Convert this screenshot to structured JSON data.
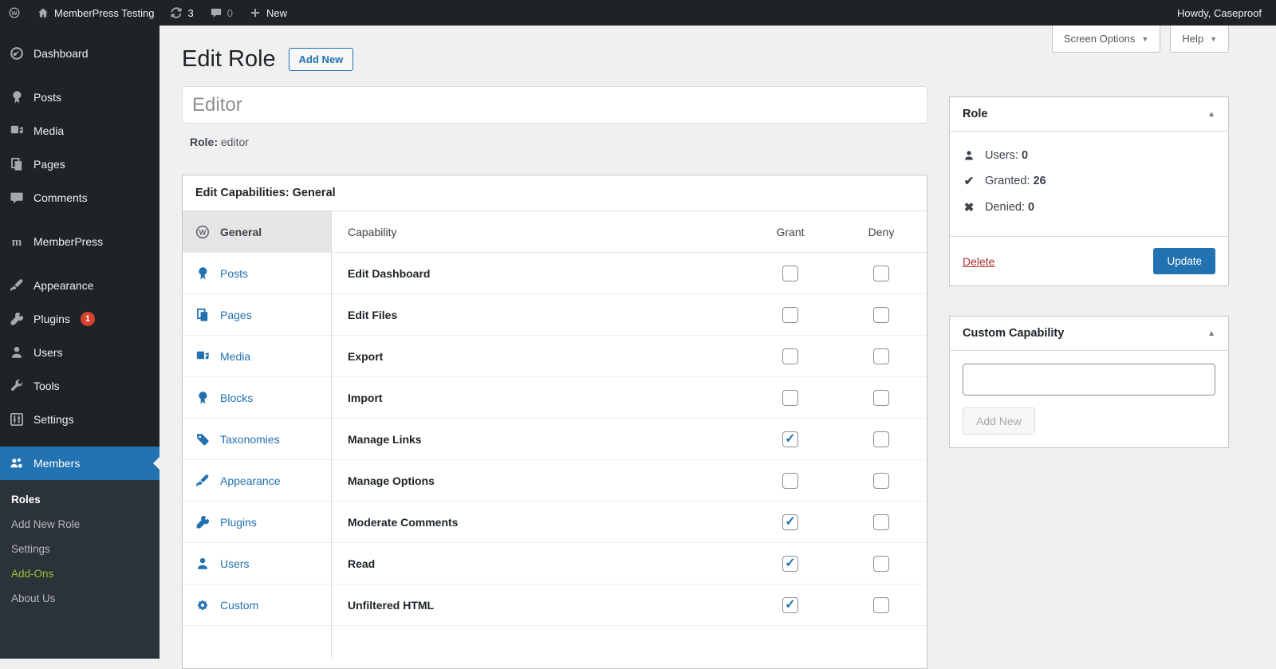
{
  "admin_bar": {
    "site_name": "MemberPress Testing",
    "update_count": "3",
    "comment_count": "0",
    "new_label": "New",
    "howdy": "Howdy, Caseproof"
  },
  "colors": {
    "accent_blue": "#2271b1",
    "menu_dark": "#1d2327",
    "submenu_bg": "#2c3338",
    "badge_red": "#d5432f",
    "addons_green": "#95bf3b",
    "delete_red": "#b32d2e"
  },
  "sidebar": {
    "items": [
      {
        "label": "Dashboard"
      },
      {
        "label": "Posts"
      },
      {
        "label": "Media"
      },
      {
        "label": "Pages"
      },
      {
        "label": "Comments"
      },
      {
        "label": "MemberPress"
      },
      {
        "label": "Appearance"
      },
      {
        "label": "Plugins",
        "badge": "1"
      },
      {
        "label": "Users"
      },
      {
        "label": "Tools"
      },
      {
        "label": "Settings"
      },
      {
        "label": "Members",
        "active": true
      }
    ],
    "submenu": [
      {
        "label": "Roles",
        "active": true
      },
      {
        "label": "Add New Role"
      },
      {
        "label": "Settings"
      },
      {
        "label": "Add-Ons",
        "highlight": true
      },
      {
        "label": "About Us"
      }
    ]
  },
  "screen_meta": {
    "screen_options_label": "Screen Options",
    "help_label": "Help"
  },
  "page": {
    "title": "Edit Role",
    "add_new_label": "Add New",
    "role_name_value": "Editor",
    "role_label": "Role:",
    "role_slug": "editor"
  },
  "capabilities": {
    "box_title": "Edit Capabilities: General",
    "tabs": [
      {
        "label": "General",
        "active": true
      },
      {
        "label": "Posts"
      },
      {
        "label": "Pages"
      },
      {
        "label": "Media"
      },
      {
        "label": "Blocks"
      },
      {
        "label": "Taxonomies"
      },
      {
        "label": "Appearance"
      },
      {
        "label": "Plugins"
      },
      {
        "label": "Users"
      },
      {
        "label": "Custom"
      }
    ],
    "columns": {
      "capability": "Capability",
      "grant": "Grant",
      "deny": "Deny"
    },
    "rows": [
      {
        "label": "Edit Dashboard",
        "grant": false,
        "deny": false
      },
      {
        "label": "Edit Files",
        "grant": false,
        "deny": false
      },
      {
        "label": "Export",
        "grant": false,
        "deny": false
      },
      {
        "label": "Import",
        "grant": false,
        "deny": false
      },
      {
        "label": "Manage Links",
        "grant": true,
        "deny": false
      },
      {
        "label": "Manage Options",
        "grant": false,
        "deny": false
      },
      {
        "label": "Moderate Comments",
        "grant": true,
        "deny": false
      },
      {
        "label": "Read",
        "grant": true,
        "deny": false
      },
      {
        "label": "Unfiltered HTML",
        "grant": true,
        "deny": false
      }
    ]
  },
  "role_box": {
    "title": "Role",
    "users_label": "Users:",
    "users_value": "0",
    "granted_label": "Granted:",
    "granted_value": "26",
    "denied_label": "Denied:",
    "denied_value": "0",
    "delete_label": "Delete",
    "update_label": "Update"
  },
  "custom_cap_box": {
    "title": "Custom Capability",
    "input_value": "",
    "add_new_label": "Add New"
  }
}
